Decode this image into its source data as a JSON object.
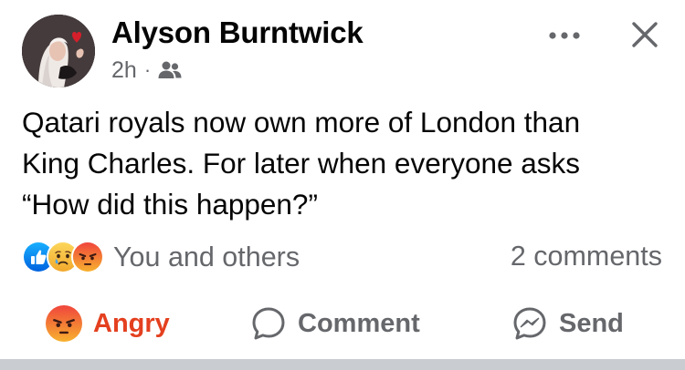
{
  "post": {
    "author": "Alyson Burntwick",
    "time": "2h",
    "separator": "·",
    "audience_icon": "friends-icon",
    "text_lines": [
      "Qatari royals now own more of London than",
      "King Charles. For later when everyone asks",
      "“How did this happen?”"
    ]
  },
  "reactions": {
    "icons": [
      "like-icon",
      "sad-icon",
      "angry-icon"
    ],
    "summary": "You and others",
    "comments": "2 comments"
  },
  "actions": {
    "angry_label": "Angry",
    "comment_label": "Comment",
    "send_label": "Send"
  },
  "colors": {
    "like_blue": "#1877f2",
    "angry_red": "#e4401f",
    "secondary_text": "#65676b",
    "reaction_yellow": "#f7b928"
  }
}
